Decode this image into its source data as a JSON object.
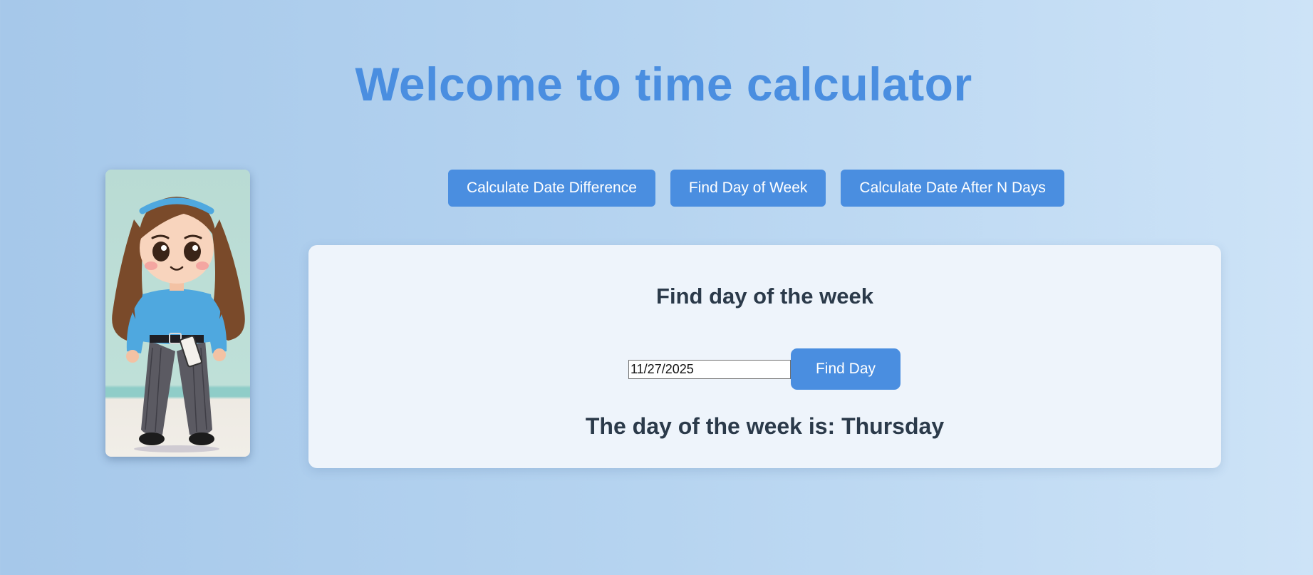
{
  "header": {
    "title": "Welcome to time calculator"
  },
  "nav": {
    "buttons": [
      {
        "label": "Calculate Date Difference"
      },
      {
        "label": "Find Day of Week"
      },
      {
        "label": "Calculate Date After N Days"
      }
    ]
  },
  "panel": {
    "title": "Find day of the week",
    "date_input_value": "11/27/2025",
    "find_button_label": "Find Day",
    "result_text": "The day of the week is: Thursday"
  },
  "colors": {
    "accent": "#4a8ee0",
    "panel_bg": "#eef4fb",
    "text_dark": "#2b3a4a"
  }
}
